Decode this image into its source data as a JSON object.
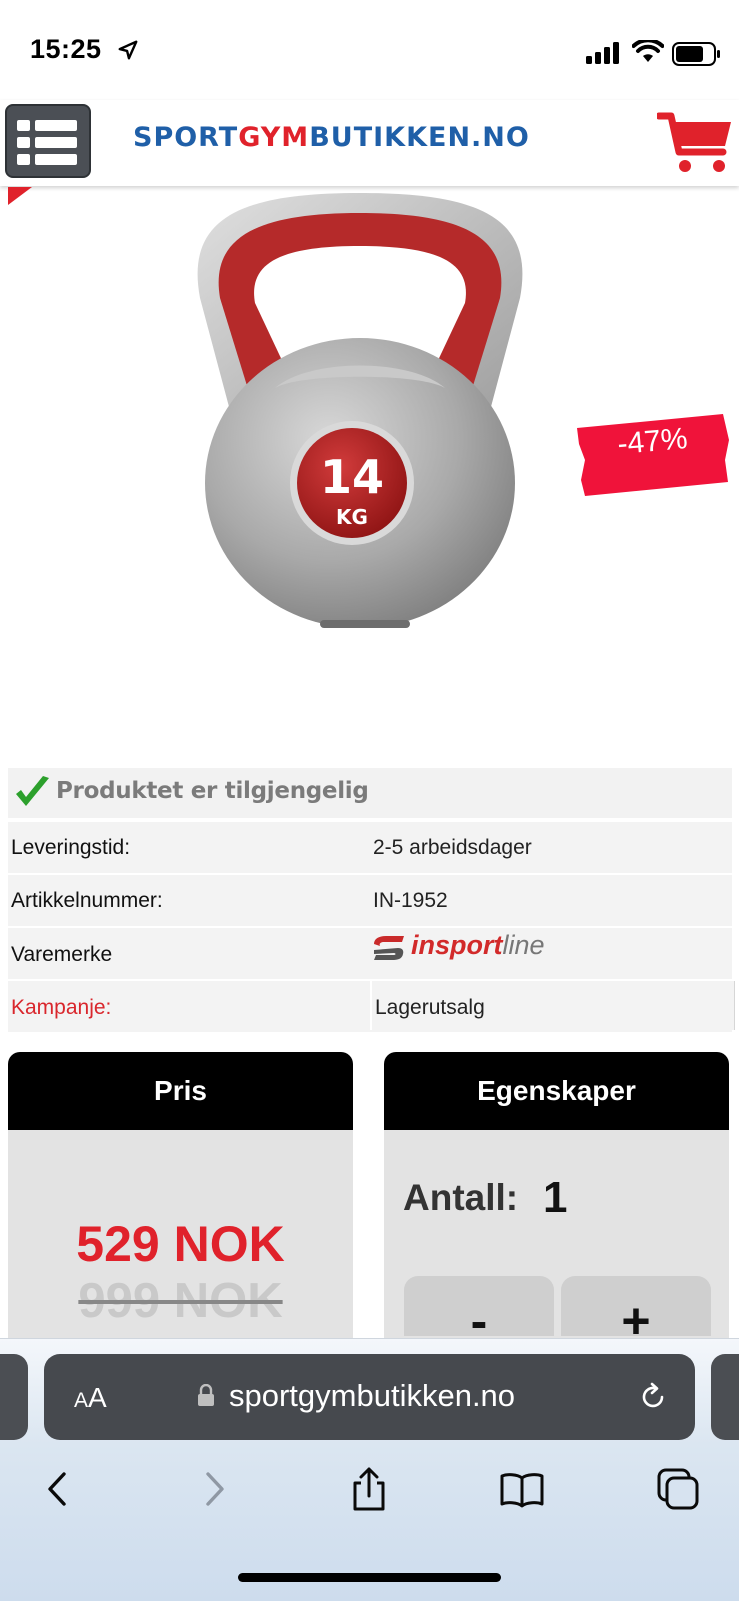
{
  "status_bar": {
    "time": "15:25"
  },
  "header": {
    "logo_part1": "SPORT",
    "logo_part2": "GYM",
    "logo_part3": "BUTIKKEN.NO"
  },
  "product": {
    "weight_number": "14",
    "weight_unit": "KG",
    "discount_badge": "-47%"
  },
  "info_table": {
    "availability": "Produktet er tilgjengelig",
    "rows": [
      {
        "label": "Leveringstid:",
        "value": "2-5 arbeidsdager"
      },
      {
        "label": "Artikkelnummer:",
        "value": "IN-1952"
      },
      {
        "label": "Varemerke",
        "value": ""
      },
      {
        "label": "Kampanje:",
        "value": "Lagerutsalg"
      }
    ],
    "brand_logo": {
      "part1": "in",
      "part2": "sport",
      "part3": "line"
    }
  },
  "price_panel": {
    "title": "Pris",
    "price_now": "529 NOK",
    "price_old": "999 NOK"
  },
  "properties_panel": {
    "title": "Egenskaper",
    "quantity_label": "Antall:",
    "quantity_value": "1",
    "minus_label": "-",
    "plus_label": "+"
  },
  "browser": {
    "text_size_label_small": "A",
    "text_size_label_large": "A",
    "url": "sportgymbutikken.no"
  },
  "colors": {
    "brand_blue": "#1f5fa8",
    "brand_red": "#e0222b",
    "panel_header": "#000000",
    "panel_body": "#e3e3e3"
  }
}
